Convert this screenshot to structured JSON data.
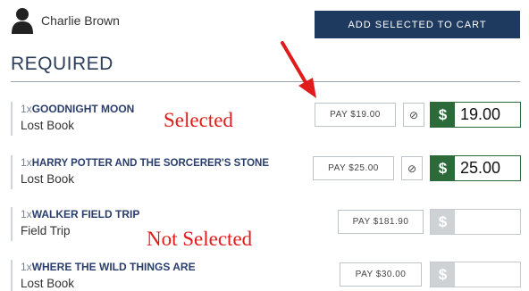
{
  "user": {
    "name": "Charlie Brown",
    "icon": "user-icon"
  },
  "toolbar": {
    "cart_label": "ADD SELECTED TO CART"
  },
  "section": {
    "title": "REQUIRED"
  },
  "items": [
    {
      "qty": "1x",
      "name": "GOODNIGHT MOON",
      "type": "Lost Book",
      "pay_label": "PAY $19.00",
      "cancel_glyph": "⊘",
      "currency": "$",
      "amount": "19.00",
      "selected": true
    },
    {
      "qty": "1x",
      "name": "HARRY POTTER AND THE SORCERER'S STONE",
      "type": "Lost Book",
      "pay_label": "PAY $25.00",
      "cancel_glyph": "⊘",
      "currency": "$",
      "amount": "25.00",
      "selected": true
    },
    {
      "qty": "1x",
      "name": "WALKER FIELD TRIP",
      "type": "Field Trip",
      "pay_label": "PAY $181.90",
      "currency": "$",
      "amount": "",
      "selected": false
    },
    {
      "qty": "1x",
      "name": "WHERE THE WILD THINGS ARE",
      "type": "Lost Book",
      "pay_label": "PAY $30.00",
      "currency": "$",
      "amount": "",
      "selected": false
    }
  ],
  "annotations": {
    "selected": "Selected",
    "not_selected": "Not Selected",
    "color": "#e01b1b"
  },
  "colors": {
    "primary": "#1f3a5f",
    "success": "#2d6a3a",
    "disabled": "#cfd2d5"
  }
}
